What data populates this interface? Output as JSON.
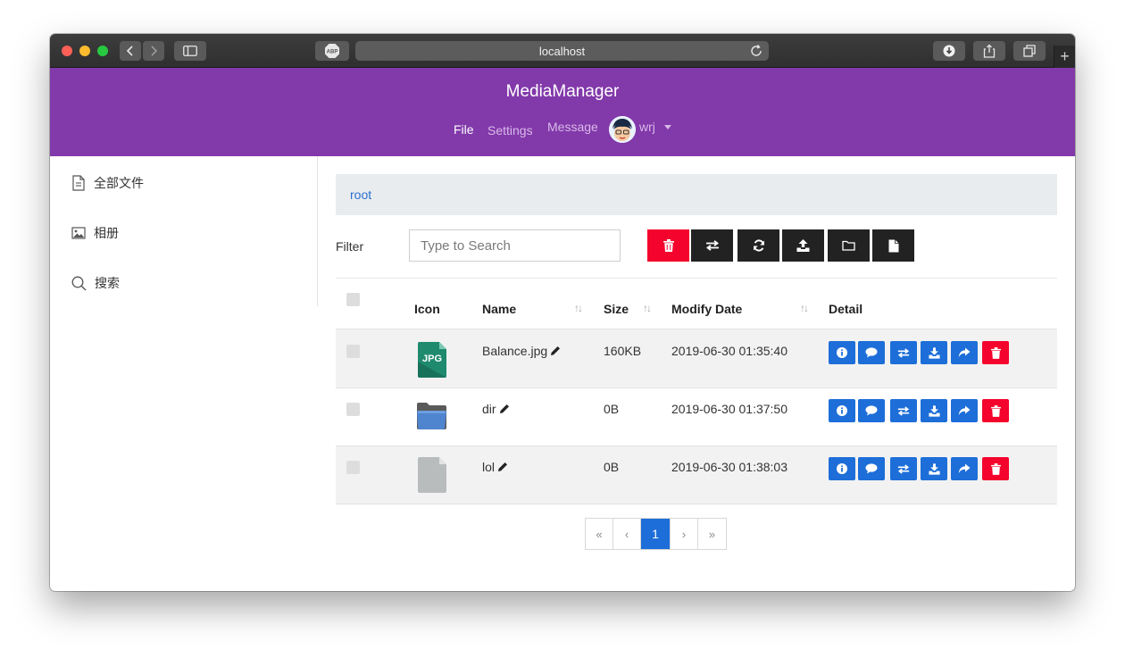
{
  "browser": {
    "url": "localhost",
    "adblock_label": "ABP",
    "newtab_label": "+"
  },
  "app": {
    "title": "MediaManager",
    "nav": {
      "file": "File",
      "settings": "Settings",
      "message": "Message",
      "user": "wrj"
    }
  },
  "sidebar": {
    "items": [
      {
        "label": "全部文件",
        "icon": "document-icon"
      },
      {
        "label": "相册",
        "icon": "image-icon"
      },
      {
        "label": "搜索",
        "icon": "search-icon"
      }
    ]
  },
  "breadcrumb": {
    "root": "root"
  },
  "toolbar": {
    "filter_label": "Filter",
    "search_placeholder": "Type to Search",
    "buttons": [
      "trash-icon",
      "swap-icon",
      "refresh-icon",
      "upload-icon",
      "folder-icon",
      "file-icon"
    ]
  },
  "table": {
    "headers": {
      "icon": "Icon",
      "name": "Name",
      "size": "Size",
      "date": "Modify Date",
      "detail": "Detail"
    },
    "rows": [
      {
        "type": "jpg",
        "icon_label": "JPG",
        "name": "Balance.jpg",
        "size": "160KB",
        "date": "2019-06-30 01:35:40"
      },
      {
        "type": "folder",
        "name": "dir",
        "size": "0B",
        "date": "2019-06-30 01:37:50"
      },
      {
        "type": "file",
        "name": "lol",
        "size": "0B",
        "date": "2019-06-30 01:38:03"
      }
    ],
    "actions": [
      "info-icon",
      "comment-icon",
      "swap-icon",
      "download-icon",
      "share-icon",
      "trash-icon"
    ]
  },
  "pagination": {
    "first": "«",
    "prev": "‹",
    "current": "1",
    "next": "›",
    "last": "»"
  },
  "colors": {
    "header": "#8239aa",
    "primary": "#1d6ed8",
    "danger": "#f4042c",
    "dark": "#222222"
  }
}
